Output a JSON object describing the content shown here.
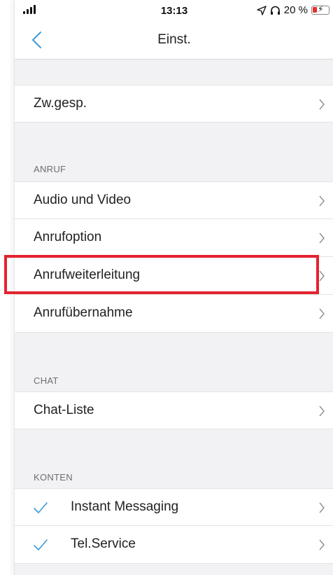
{
  "status_bar": {
    "time": "13:13",
    "battery_text": "20 %",
    "location_icon": "location-arrow-icon",
    "headphones_icon": "headphones-icon",
    "battery_color": "#e5302f",
    "battery_level": 0.2
  },
  "nav": {
    "title": "Einst.",
    "back_icon": "chevron-left-icon"
  },
  "rows": {
    "zwgesp": "Zw.gesp."
  },
  "sections": {
    "anruf": {
      "header": "ANRUF",
      "items": [
        "Audio und Video",
        "Anrufoption",
        "Anrufweiterleitung",
        "Anrufübernahme"
      ]
    },
    "chat": {
      "header": "CHAT",
      "items": [
        "Chat-Liste"
      ]
    },
    "konten": {
      "header": "KONTEN",
      "items": [
        "Instant Messaging",
        "Tel.Service"
      ]
    }
  },
  "colors": {
    "accent": "#3d9ad6",
    "highlight": "#e3232f",
    "background": "#f2f2f4"
  }
}
